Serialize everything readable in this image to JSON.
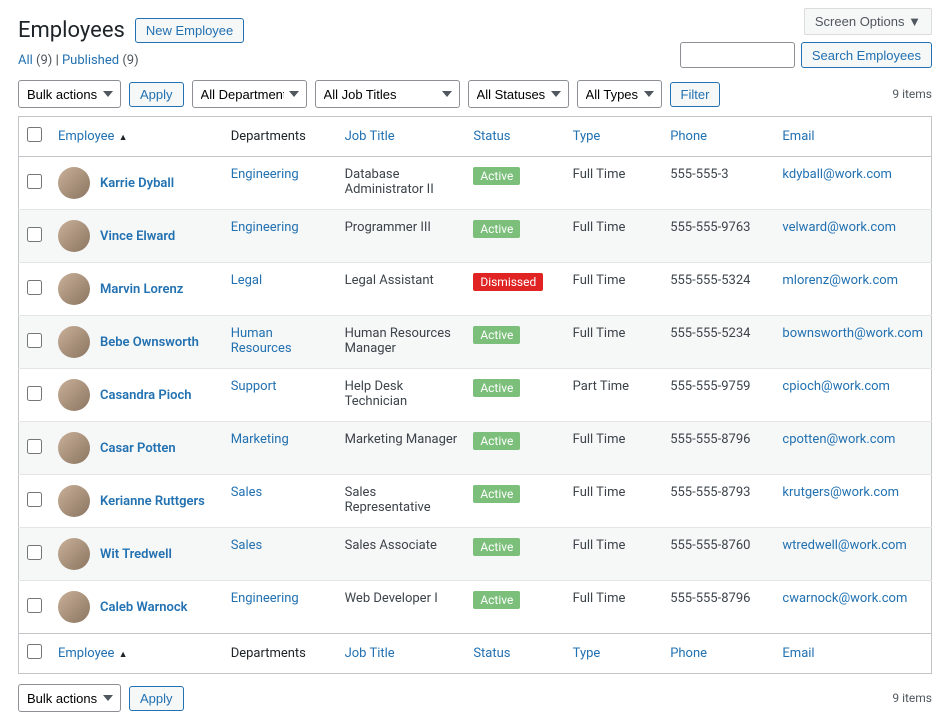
{
  "header": {
    "screen_options": "Screen Options",
    "title": "Employees",
    "new_button": "New Employee"
  },
  "views": {
    "all_label": "All",
    "all_count": "(9)",
    "sep": " | ",
    "published_label": "Published",
    "published_count": "(9)"
  },
  "search": {
    "button": "Search Employees",
    "value": ""
  },
  "filters": {
    "bulk_actions": "Bulk actions",
    "apply": "Apply",
    "all_departments": "All Departments",
    "all_job_titles": "All Job Titles",
    "all_statuses": "All Statuses",
    "all_types": "All Types",
    "filter": "Filter"
  },
  "items_count": "9 items",
  "columns": {
    "employee": "Employee",
    "departments": "Departments",
    "job_title": "Job Title",
    "status": "Status",
    "type": "Type",
    "phone": "Phone",
    "email": "Email"
  },
  "rows": [
    {
      "name": "Karrie Dyball",
      "dept": "Engineering",
      "title": "Database Administrator II",
      "status": "Active",
      "status_class": "active",
      "type": "Full Time",
      "phone": "555-555-3",
      "email": "kdyball@work.com"
    },
    {
      "name": "Vince Elward",
      "dept": "Engineering",
      "title": "Programmer III",
      "status": "Active",
      "status_class": "active",
      "type": "Full Time",
      "phone": "555-555-9763",
      "email": "velward@work.com"
    },
    {
      "name": "Marvin Lorenz",
      "dept": "Legal",
      "title": "Legal Assistant",
      "status": "Dismissed",
      "status_class": "dismissed",
      "type": "Full Time",
      "phone": "555-555-5324",
      "email": "mlorenz@work.com"
    },
    {
      "name": "Bebe Ownsworth",
      "dept": "Human Resources",
      "title": "Human Resources Manager",
      "status": "Active",
      "status_class": "active",
      "type": "Full Time",
      "phone": "555-555-5234",
      "email": "bownsworth@work.com"
    },
    {
      "name": "Casandra Pioch",
      "dept": "Support",
      "title": "Help Desk Technician",
      "status": "Active",
      "status_class": "active",
      "type": "Part Time",
      "phone": "555-555-9759",
      "email": "cpioch@work.com"
    },
    {
      "name": "Casar Potten",
      "dept": "Marketing",
      "title": "Marketing Manager",
      "status": "Active",
      "status_class": "active",
      "type": "Full Time",
      "phone": "555-555-8796",
      "email": "cpotten@work.com"
    },
    {
      "name": "Kerianne Ruttgers",
      "dept": "Sales",
      "title": "Sales Representative",
      "status": "Active",
      "status_class": "active",
      "type": "Full Time",
      "phone": "555-555-8793",
      "email": "krutgers@work.com"
    },
    {
      "name": "Wit Tredwell",
      "dept": "Sales",
      "title": "Sales Associate",
      "status": "Active",
      "status_class": "active",
      "type": "Full Time",
      "phone": "555-555-8760",
      "email": "wtredwell@work.com"
    },
    {
      "name": "Caleb Warnock",
      "dept": "Engineering",
      "title": "Web Developer I",
      "status": "Active",
      "status_class": "active",
      "type": "Full Time",
      "phone": "555-555-8796",
      "email": "cwarnock@work.com"
    }
  ]
}
